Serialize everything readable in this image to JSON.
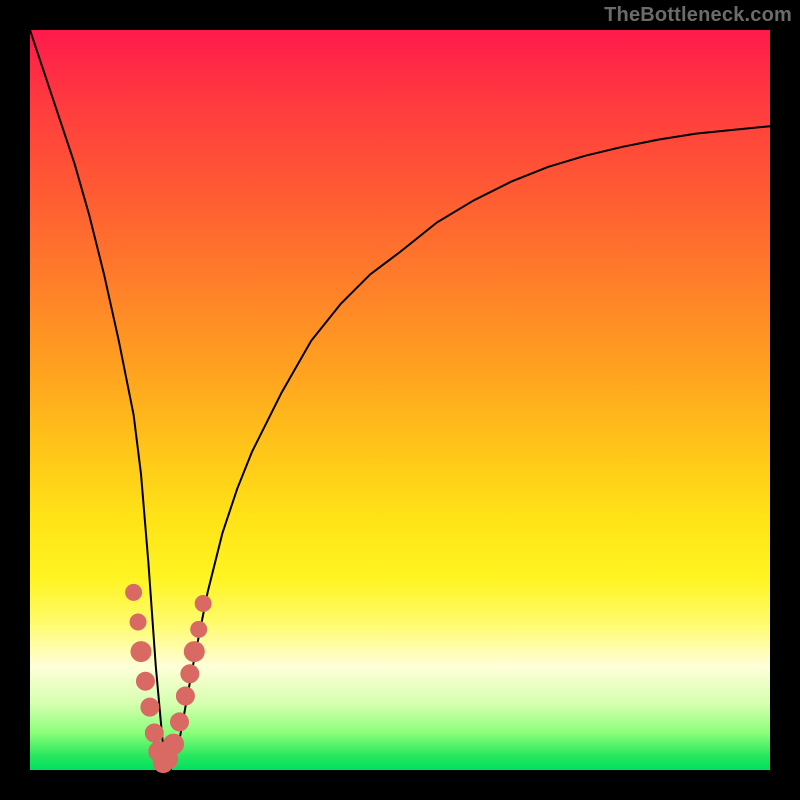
{
  "watermark": "TheBottleneck.com",
  "colors": {
    "frame": "#000000",
    "curve": "#000000",
    "marker": "#d96a63",
    "gradient_stops": [
      "#ff1a4b",
      "#ff3b3f",
      "#ff5b33",
      "#ff7e2a",
      "#ffa21f",
      "#ffc319",
      "#ffe317",
      "#fff421",
      "#fffb6a",
      "#ffffd8",
      "#d6ffb0",
      "#8aff7a",
      "#29e85e",
      "#00e060"
    ]
  },
  "chart_data": {
    "type": "line",
    "title": "",
    "xlabel": "",
    "ylabel": "",
    "xlim": [
      0,
      100
    ],
    "ylim": [
      0,
      100
    ],
    "grid": false,
    "series": [
      {
        "name": "bottleneck-curve",
        "x": [
          0,
          2,
          4,
          6,
          8,
          10,
          12,
          14,
          15,
          16,
          17,
          18,
          19,
          20,
          22,
          24,
          26,
          28,
          30,
          34,
          38,
          42,
          46,
          50,
          55,
          60,
          65,
          70,
          75,
          80,
          85,
          90,
          95,
          100
        ],
        "values": [
          100,
          94,
          88,
          82,
          75,
          67,
          58,
          48,
          40,
          28,
          14,
          3,
          0,
          3,
          14,
          24,
          32,
          38,
          43,
          51,
          58,
          63,
          67,
          70,
          74,
          77,
          79.5,
          81.5,
          83,
          84.2,
          85.2,
          86,
          86.5,
          87
        ]
      }
    ],
    "markers": {
      "name": "highlight-points",
      "x": [
        14.0,
        14.6,
        15.0,
        15.6,
        16.2,
        16.8,
        17.4,
        18.0,
        18.6,
        19.4,
        20.2,
        21.0,
        21.6,
        22.2,
        22.8,
        23.4
      ],
      "values": [
        24.0,
        20.0,
        16.0,
        12.0,
        8.5,
        5.0,
        2.5,
        1.0,
        1.5,
        3.5,
        6.5,
        10.0,
        13.0,
        16.0,
        19.0,
        22.5
      ],
      "r": [
        8,
        8,
        10,
        9,
        9,
        9,
        10,
        10,
        10,
        10,
        9,
        9,
        9,
        10,
        8,
        8
      ]
    }
  }
}
